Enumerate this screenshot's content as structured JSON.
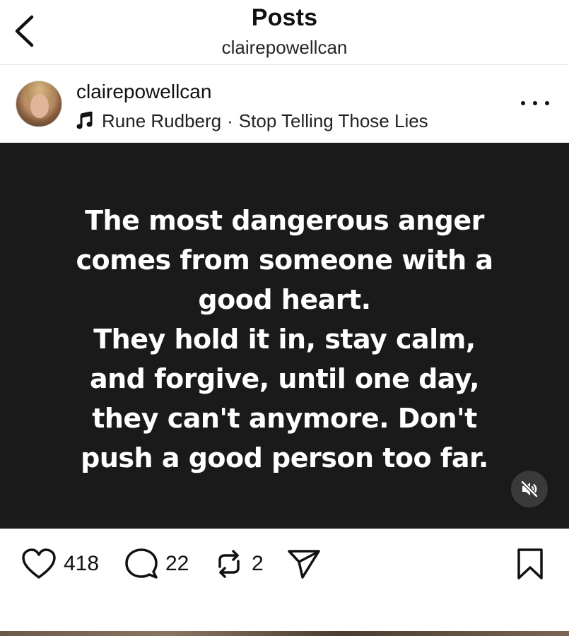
{
  "header": {
    "title": "Posts",
    "subtitle": "clairepowellcan"
  },
  "post": {
    "username": "clairepowellcan",
    "music": {
      "artist": "Rune Rudberg",
      "separator": "·",
      "song": "Stop Telling Those Lies"
    },
    "quote_text": "The most dangerous anger\ncomes from someone with a\ngood heart.\nThey hold it in, stay calm,\nand forgive, until one day,\nthey can't anymore. Don't\npush a good person too far.",
    "media_background": "#1a1a1a",
    "audio_muted": true
  },
  "actions": {
    "likes": "418",
    "comments": "22",
    "reposts": "2"
  },
  "icons": {
    "back": "chevron-left-icon",
    "more": "more-horizontal-icon",
    "music": "music-note-icon",
    "mute": "speaker-muted-icon",
    "like": "heart-icon",
    "comment": "comment-bubble-icon",
    "repost": "repost-icon",
    "share": "send-icon",
    "save": "bookmark-icon"
  }
}
